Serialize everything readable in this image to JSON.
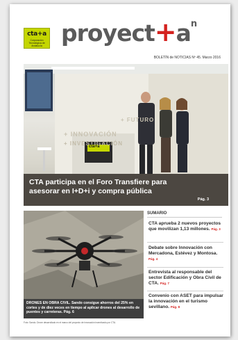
{
  "masthead": {
    "logo_text": "cta+a",
    "logo_sub": "Corporación Tecnológica de Andalucía",
    "brand_prefix": "proyect",
    "brand_plus": "+",
    "brand_suffix": "a",
    "brand_sup": "n",
    "issue_line": "BOLETÍN de NOTICIAS Nº 45. Marzo 2016"
  },
  "hero": {
    "title": "CTA participa en el Foro Transfiere para asesorar en I+D+i y compra pública",
    "page_ref": "Pág. 3",
    "wall_text_1": "+ INNOVACIÓN",
    "wall_text_2": "+ FUTURO",
    "wall_text_3": "+ INVESTIGACIÓN",
    "booth_logo": "cta+a"
  },
  "drone": {
    "caption": "DRONES EN OBRA CIVIL. Sando consigue ahorros del 25% en cortes y de diez veces en tiempo al aplicar drones al desarrollo de puentes y carreteras. Pág. 6",
    "footnote": "Foto: Sando. Drone desarrollado en el marco del proyecto de innovación incentivado por CTA."
  },
  "sumario": {
    "heading": "SUMARIO",
    "items": [
      {
        "text": "CTA aprueba 2 nuevos proyectos que movilizan 1,13 millones.",
        "page": "Pág. 3"
      },
      {
        "text": "Debate sobre Innovación con Mercadona, Estévez y Montosa.",
        "page": "Pág. 4"
      },
      {
        "text": "Entrevista al responsable del sector Edificación y Obra Civil de CTA.",
        "page": "Pág. 7"
      },
      {
        "text": "Convenio con ASET para impulsar la innovación en el turismo sevillano.",
        "page": "Pág. 8"
      }
    ]
  },
  "colors": {
    "accent_red": "#d4221f",
    "logo_green": "#c4d600",
    "brand_gray": "#5b5b5b"
  }
}
